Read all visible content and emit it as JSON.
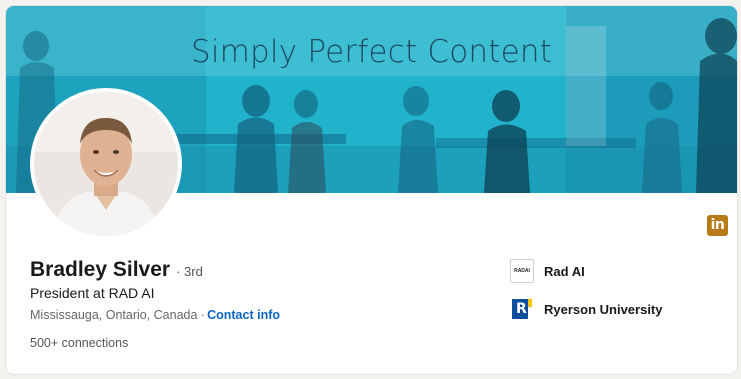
{
  "banner": {
    "title": "Simply Perfect Content"
  },
  "profile": {
    "name": "Bradley Silver",
    "degree": "· 3rd",
    "headline": "President at RAD AI",
    "location": "Mississauga, Ontario, Canada ·",
    "contact_label": "Contact info",
    "connections": "500+ connections"
  },
  "linkedin_badge": {
    "text": "in",
    "color": "#b87a16"
  },
  "organizations": [
    {
      "name": "Rad AI",
      "logo_text": "RADAI",
      "icon": "rad-ai-logo"
    },
    {
      "name": "Ryerson University",
      "logo_text": "R",
      "icon": "ryerson-logo"
    }
  ],
  "colors": {
    "link": "#0a66c2",
    "banner": "#1fb7cf"
  }
}
